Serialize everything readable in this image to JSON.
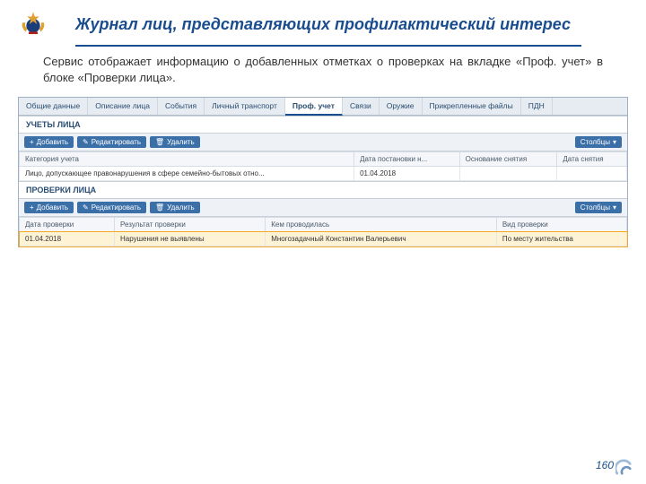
{
  "header": {
    "title": "Журнал лиц, представляющих профилактический интерес"
  },
  "desc": "Сервис отображает информацию о добавленных отметках о проверках на вкладке «Проф. учет» в блоке «Проверки лица».",
  "tabs": [
    {
      "label": "Общие данные"
    },
    {
      "label": "Описание лица"
    },
    {
      "label": "События"
    },
    {
      "label": "Личный транспорт"
    },
    {
      "label": "Проф. учет"
    },
    {
      "label": "Связи"
    },
    {
      "label": "Оружие"
    },
    {
      "label": "Прикрепленные файлы"
    },
    {
      "label": "ПДН"
    }
  ],
  "active_tab": 4,
  "section_uch": {
    "title": "УЧЕТЫ ЛИЦА",
    "toolbar": {
      "add": "Добавить",
      "edit": "Редактировать",
      "delete": "Удалить",
      "cols": "Столбцы"
    },
    "headers": [
      "Категория учета",
      "Дата постановки н...",
      "Основание снятия",
      "Дата снятия"
    ],
    "rows": [
      [
        "Лицо, допускающее правонарушения в сфере семейно-бытовых отно...",
        "01.04.2018",
        "",
        ""
      ]
    ]
  },
  "section_prov": {
    "title": "ПРОВЕРКИ ЛИЦА",
    "toolbar": {
      "add": "Добавить",
      "edit": "Редактировать",
      "delete": "Удалить",
      "cols": "Столбцы"
    },
    "headers": [
      "Дата проверки",
      "Результат проверки",
      "Кем проводилась",
      "Вид проверки"
    ],
    "rows": [
      [
        "01.04.2018",
        "Нарушения не выявлены",
        "Многозадачный Константин Валерьевич",
        "По месту жительства"
      ]
    ]
  },
  "page_number": "160"
}
